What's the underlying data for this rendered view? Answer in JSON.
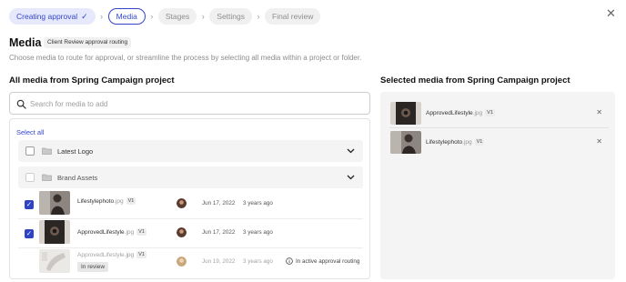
{
  "stepper": {
    "steps": [
      {
        "label": "Creating approval",
        "state": "done"
      },
      {
        "label": "Media",
        "state": "current"
      },
      {
        "label": "Stages",
        "state": "todo"
      },
      {
        "label": "Settings",
        "state": "todo"
      },
      {
        "label": "Final review",
        "state": "todo"
      }
    ],
    "separator": "›",
    "check_icon": "✓"
  },
  "close_icon": "✕",
  "header": {
    "title": "Media",
    "badge": "Client Review approval routing",
    "subtitle": "Choose media to route for approval, or streamline the process by selecting all media within a project or folder."
  },
  "left": {
    "title": "All media from Spring Campaign project",
    "search_placeholder": "Search for media to add",
    "select_all": "Select all",
    "folders": [
      {
        "name": "Latest Logo",
        "checked": false
      },
      {
        "name": "Brand Assets",
        "checked": false
      }
    ],
    "files": [
      {
        "name": "Lifestylephoto",
        "ext": ".jpg",
        "version": "V1",
        "date": "Jun 17, 2022",
        "ago": "3 years ago",
        "checked": true,
        "status": null
      },
      {
        "name": "ApprovedLifestyle",
        "ext": ".jpg",
        "version": "V1",
        "date": "Jun 17, 2022",
        "ago": "3 years ago",
        "checked": true,
        "status": null
      },
      {
        "name": "ApprovedLifestyle",
        "ext": ".jpg",
        "version": "V1",
        "date": "Jun 19, 2022",
        "ago": "3 years ago",
        "checked": false,
        "badge": "In review",
        "status": "In active approval routing"
      }
    ]
  },
  "right": {
    "title": "Selected media from Spring Campaign project",
    "items": [
      {
        "name": "ApprovedLifestyle",
        "ext": ".jpg",
        "version": "V1"
      },
      {
        "name": "Lifestylephoto",
        "ext": ".jpg",
        "version": "V1"
      }
    ],
    "remove_icon": "✕"
  },
  "colors": {
    "accent": "#3346c9",
    "accent_light": "#e6e9fb",
    "panel_bg": "#f4f4f4"
  }
}
